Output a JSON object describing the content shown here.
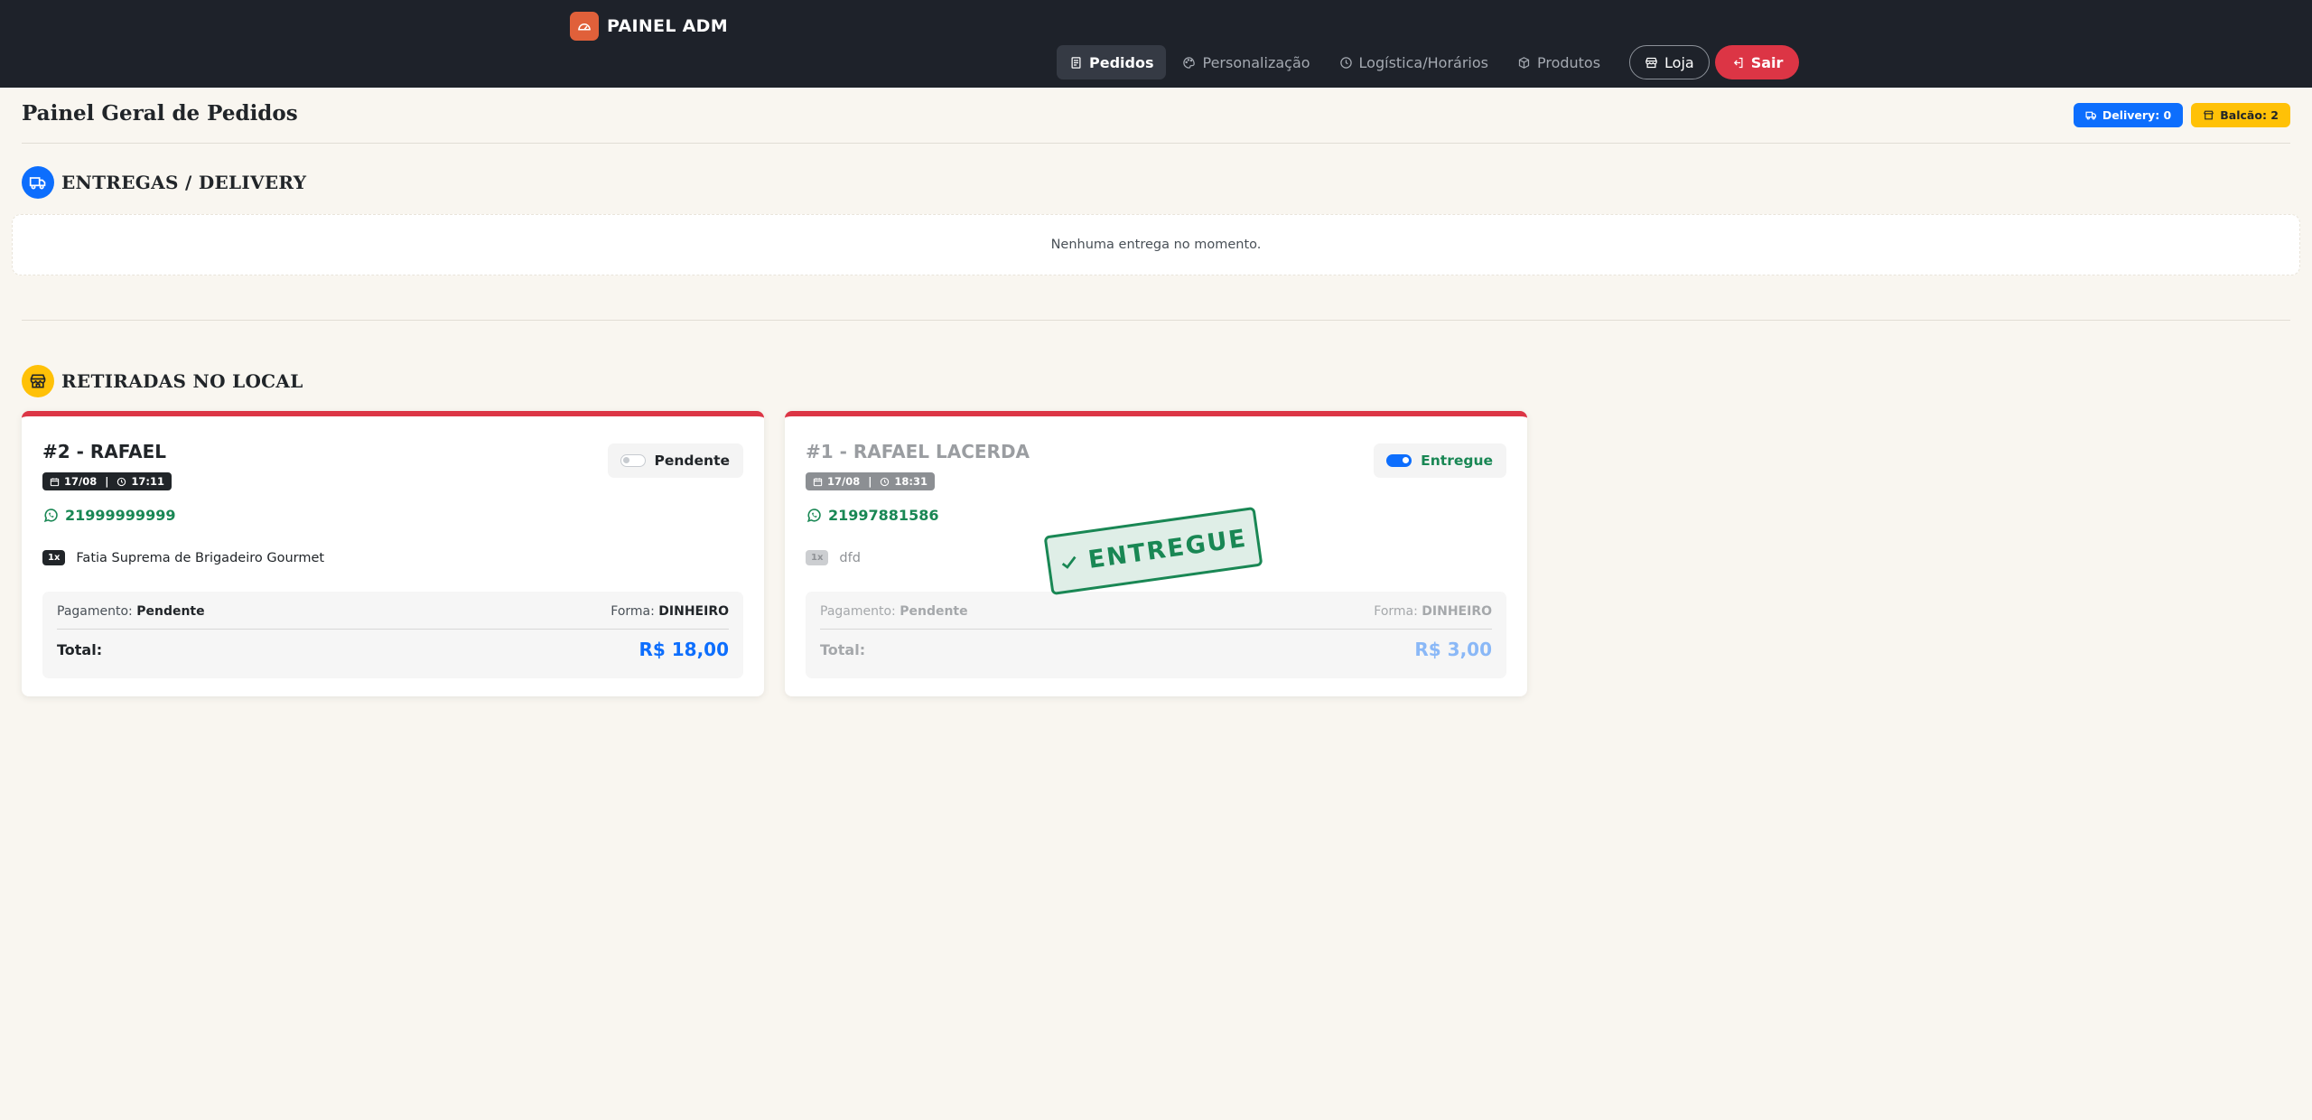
{
  "brand": {
    "title": "PAINEL ADM"
  },
  "nav": {
    "items": [
      {
        "label": "Pedidos",
        "icon": "receipt-icon",
        "active": true
      },
      {
        "label": "Personalização",
        "icon": "palette-icon",
        "active": false
      },
      {
        "label": "Logística/Horários",
        "icon": "clock-icon",
        "active": false
      },
      {
        "label": "Produtos",
        "icon": "box-icon",
        "active": false
      }
    ],
    "loja_label": "Loja",
    "sair_label": "Sair"
  },
  "header": {
    "title": "Painel Geral de Pedidos",
    "badge_delivery": "Delivery: 0",
    "badge_balcao": "Balcão: 2"
  },
  "delivery_section": {
    "title": "ENTREGAS / DELIVERY",
    "empty_text": "Nenhuma entrega no momento."
  },
  "pickup_section": {
    "title": "RETIRADAS NO LOCAL",
    "orders": [
      {
        "name": "#2 - RAFAEL",
        "date": "17/08",
        "time": "17:11",
        "status": "Pendente",
        "phone": "21999999999",
        "qty": "1x",
        "item": "Fatia Suprema de Brigadeiro Gourmet",
        "payment_label": "Pagamento:",
        "payment_status": "Pendente",
        "method_label": "Forma:",
        "method": "DINHEIRO",
        "total_label": "Total:",
        "total": "R$ 18,00"
      },
      {
        "name": "#1 - RAFAEL LACERDA",
        "date": "17/08",
        "time": "18:31",
        "status": "Entregue",
        "phone": "21997881586",
        "qty": "1x",
        "item": "dfd",
        "payment_label": "Pagamento:",
        "payment_status": "Pendente",
        "method_label": "Forma:",
        "method": "DINHEIRO",
        "total_label": "Total:",
        "total": "R$ 3,00",
        "stamp": "ENTREGUE"
      }
    ]
  },
  "colors": {
    "navbar": "#1e222a",
    "accent_blue": "#0d6efd",
    "accent_yellow": "#ffc107",
    "danger": "#dc3545",
    "success": "#198754"
  }
}
